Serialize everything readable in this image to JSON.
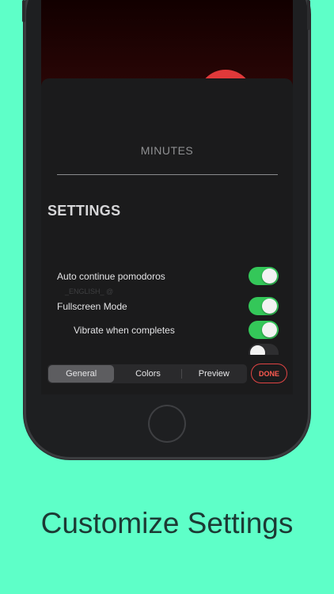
{
  "header": {
    "minutes_label": "MINUTES"
  },
  "settings": {
    "title": "SETTINGS",
    "ghost_text": "_ENGLISH_ @",
    "rows": [
      {
        "label": "Auto continue pomodoros",
        "enabled": true
      },
      {
        "label": "Fullscreen Mode",
        "enabled": true
      },
      {
        "label": "Vibrate when completes",
        "enabled": true
      }
    ]
  },
  "tabs": [
    {
      "label": "General",
      "selected": true
    },
    {
      "label": "Colors",
      "selected": false
    },
    {
      "label": "Preview",
      "selected": false
    }
  ],
  "done_label": "DONE",
  "caption": "Customize Settings",
  "colors": {
    "background": "#5effc8",
    "toggle_on": "#34c759",
    "done": "#ff5a50"
  }
}
